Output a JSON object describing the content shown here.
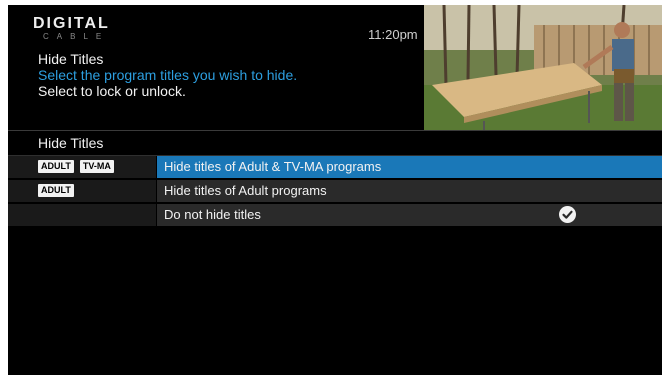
{
  "header": {
    "logo_main": "DIGITAL",
    "logo_sub": "CABLE",
    "time": "11:20pm"
  },
  "info": {
    "title": "Hide Titles",
    "instruction": "Select the program titles you wish to hide.",
    "hint": "Select to lock or unlock."
  },
  "section": {
    "title": "Hide Titles"
  },
  "options": [
    {
      "label": "Hide titles of Adult & TV-MA programs",
      "badges": [
        "ADULT",
        "TV-MA"
      ],
      "selected": true,
      "checked": false
    },
    {
      "label": "Hide titles of Adult programs",
      "badges": [
        "ADULT"
      ],
      "selected": false,
      "checked": false
    },
    {
      "label": "Do not hide titles",
      "badges": [],
      "selected": false,
      "checked": true
    }
  ],
  "colors": {
    "highlight": "#1a78b8",
    "accent_text": "#2d9fe0",
    "background": "#000000"
  },
  "icons": [
    "checkmark-icon",
    "digital-cable-logo"
  ]
}
